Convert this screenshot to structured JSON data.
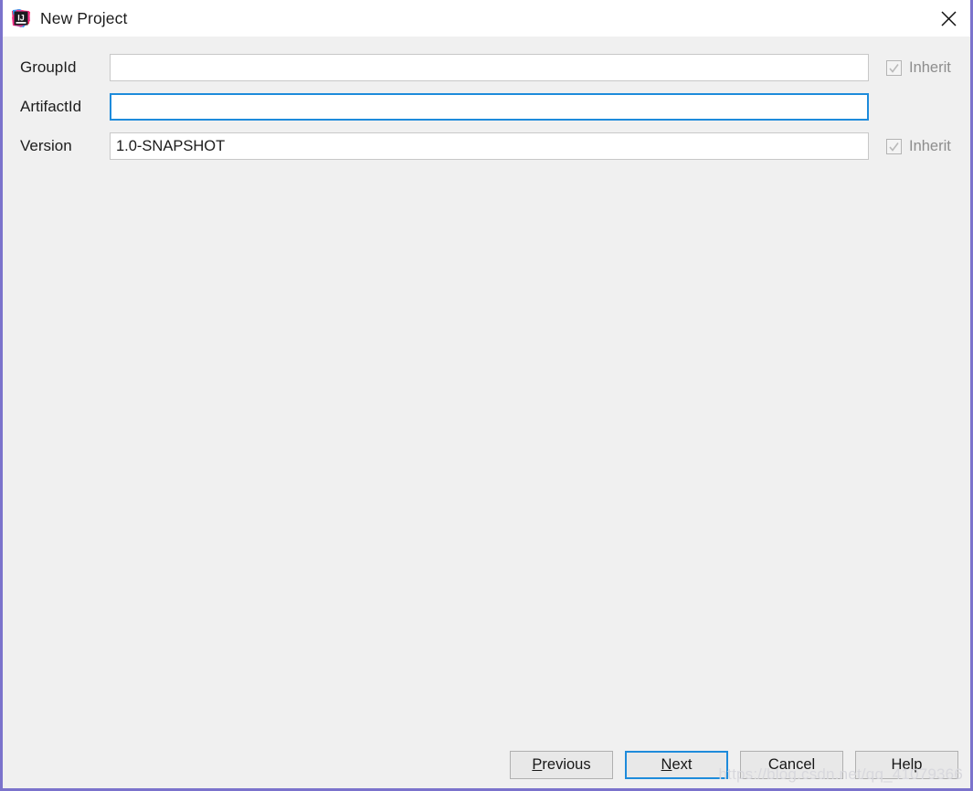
{
  "window": {
    "title": "New Project",
    "app_icon": "intellij-idea-logo",
    "close_icon": "close-icon",
    "border_color": "#7b73cc",
    "titlebar_bg": "#ffffff",
    "body_bg": "#f0f0f0"
  },
  "form": {
    "rows": [
      {
        "label": "GroupId",
        "value": "",
        "placeholder": "",
        "focused": false,
        "inherit": {
          "visible": true,
          "label": "Inherit",
          "checked": true,
          "disabled": true
        }
      },
      {
        "label": "ArtifactId",
        "value": "",
        "placeholder": "",
        "focused": true,
        "inherit": {
          "visible": false,
          "label": "",
          "checked": false,
          "disabled": true
        }
      },
      {
        "label": "Version",
        "value": "1.0-SNAPSHOT",
        "placeholder": "",
        "focused": false,
        "inherit": {
          "visible": true,
          "label": "Inherit",
          "checked": true,
          "disabled": true
        }
      }
    ]
  },
  "footer": {
    "buttons": [
      {
        "label": "Previous",
        "mnemonic": "P",
        "focused": false,
        "enabled": true
      },
      {
        "label": "Next",
        "mnemonic": "N",
        "focused": true,
        "enabled": true
      },
      {
        "label": "Cancel",
        "mnemonic": "",
        "focused": false,
        "enabled": true
      },
      {
        "label": "Help",
        "mnemonic": "",
        "focused": false,
        "enabled": true
      }
    ]
  },
  "watermark": {
    "text": "https://blog.csdn.net/qq_41079366",
    "color": "#d8d8dd"
  },
  "colors": {
    "focus_blue": "#1e8bdb",
    "field_border": "#c8c8c8",
    "disabled_text": "#8d8d8d",
    "button_bg": "#e8e8e8"
  }
}
